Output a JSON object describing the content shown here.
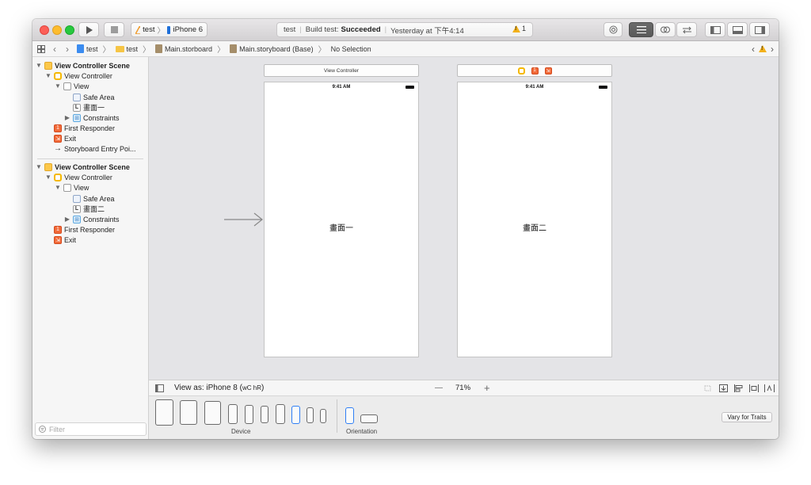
{
  "toolbar": {
    "scheme_project": "test",
    "scheme_device": "iPhone 6",
    "activity_project": "test",
    "activity_status_prefix": "Build test:",
    "activity_status": "Succeeded",
    "activity_time": "Yesterday at 下午4:14",
    "warning_count": "1"
  },
  "jumpbar": {
    "crumbs": [
      "test",
      "test",
      "Main.storboard",
      "Main.storyboard (Base)",
      "No Selection"
    ]
  },
  "navigator": {
    "scene1": {
      "title": "View Controller Scene",
      "controller": "View Controller",
      "view": "View",
      "safe_area": "Safe Area",
      "label": "畫面一",
      "constraints": "Constraints",
      "first_responder": "First Responder",
      "exit": "Exit",
      "entry_point": "Storyboard Entry Poi..."
    },
    "scene2": {
      "title": "View Controller Scene",
      "controller": "View Controller",
      "view": "View",
      "safe_area": "Safe Area",
      "label": "畫面二",
      "constraints": "Constraints",
      "first_responder": "First Responder",
      "exit": "Exit"
    },
    "filter_placeholder": "Filter"
  },
  "canvas": {
    "scene1_bar_label": "View Controller",
    "scene1_time": "9:41 AM",
    "scene1_title": "畫面一",
    "scene2_time": "9:41 AM",
    "scene2_title": "畫面二"
  },
  "bottom": {
    "view_as_label": "View as: iPhone 8 (",
    "view_as_traits": "wC hR",
    "view_as_close": ")",
    "zoom": "71%",
    "zoom_minus": "—",
    "zoom_plus": "+",
    "device_label": "Device",
    "orientation_label": "Orientation",
    "vary_label": "Vary for Traits"
  },
  "colors": {
    "accent": "#2f7ff5",
    "warning": "#f3b11b",
    "scene_icon": "#fcc84a",
    "responder_icon": "#f26b3a"
  }
}
